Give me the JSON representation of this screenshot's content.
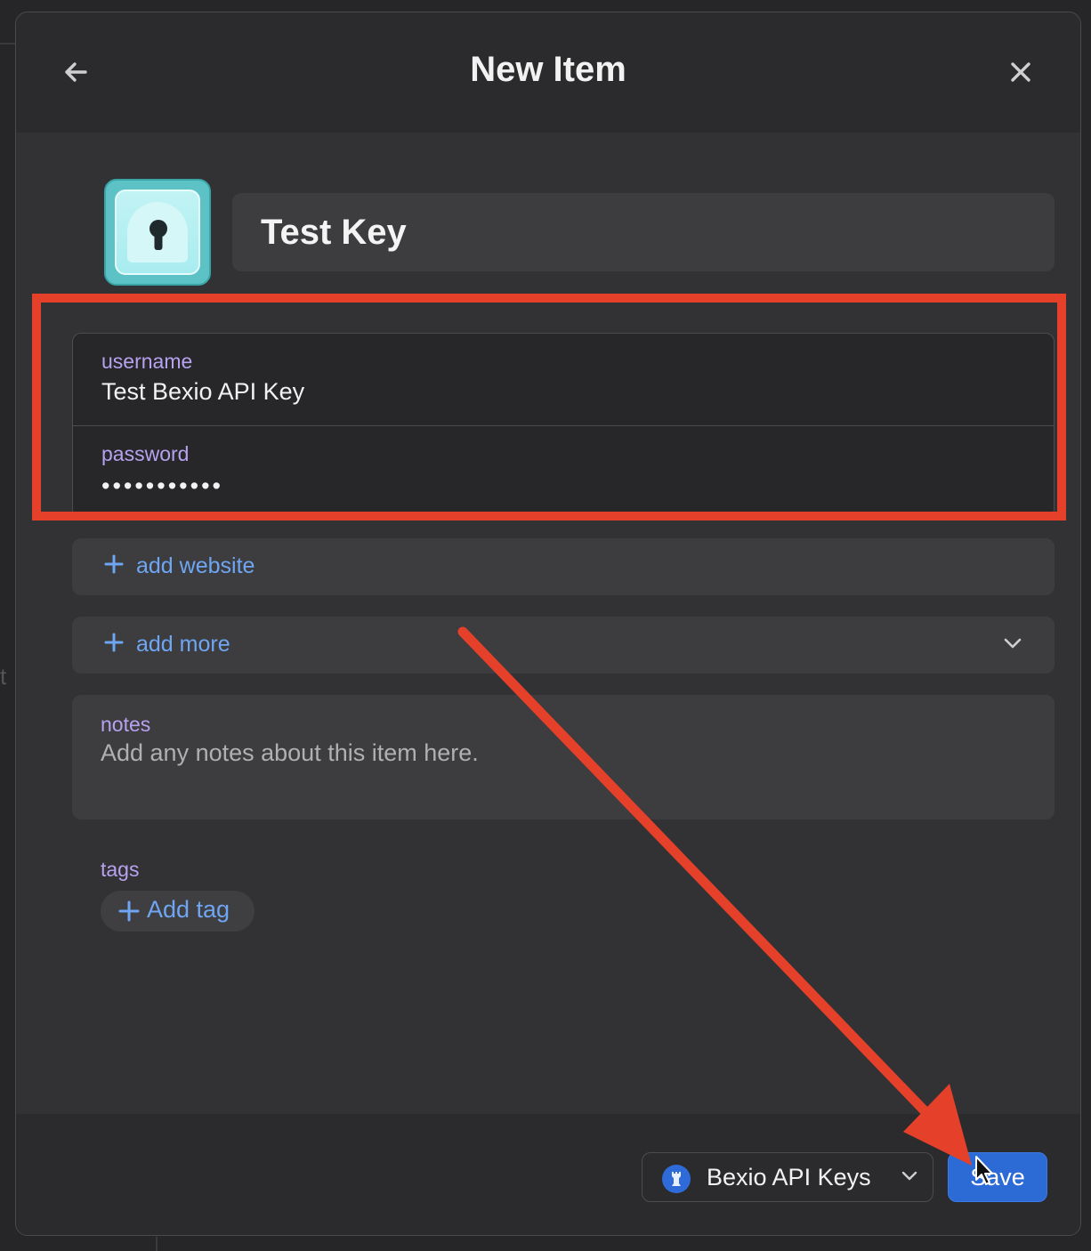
{
  "dialog": {
    "title": "New Item",
    "item_name": "Test Key"
  },
  "credentials": {
    "username_label": "username",
    "username_value": "Test Bexio API Key",
    "password_label": "password",
    "password_value": "•••••••••••"
  },
  "actions": {
    "add_website": "add website",
    "add_more": "add more"
  },
  "notes": {
    "label": "notes",
    "placeholder": "Add any notes about this item here."
  },
  "tags": {
    "label": "tags",
    "add_tag": "Add tag"
  },
  "footer": {
    "vault_name": "Bexio API Keys",
    "save_label": "Save"
  },
  "colors": {
    "accent_blue": "#2c6ad6",
    "link_blue": "#6fa6f3",
    "label_purple": "#b7a2f0",
    "annotation_red": "#e5402a",
    "icon_teal": "#5cc2c5"
  },
  "icons": [
    "back-arrow-icon",
    "close-icon",
    "keyhole-icon",
    "plus-icon",
    "chevron-down-icon",
    "vault-icon",
    "mouse-cursor-icon"
  ]
}
